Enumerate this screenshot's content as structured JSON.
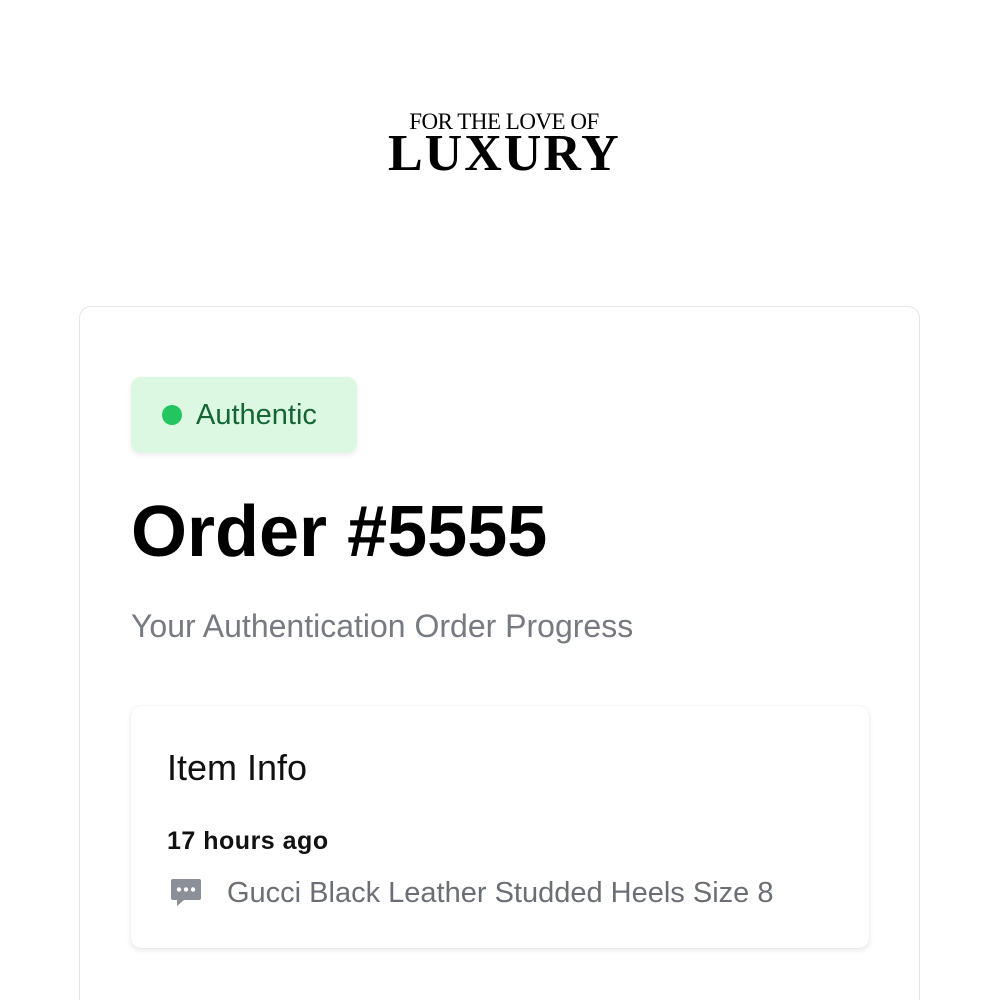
{
  "logo": {
    "top_text": "FOR THE LOVE OF",
    "bottom_text": "LUXURY"
  },
  "status_badge": {
    "label": "Authentic",
    "dot_color": "#22c55e",
    "background_color": "#dcf8e3",
    "text_color": "#166534"
  },
  "order": {
    "title": "Order #5555",
    "subtitle": "Your Authentication Order Progress"
  },
  "item_info": {
    "title": "Item Info",
    "time": "17 hours ago",
    "icon": "comment-icon",
    "description": "Gucci Black Leather Studded Heels Size 8"
  }
}
